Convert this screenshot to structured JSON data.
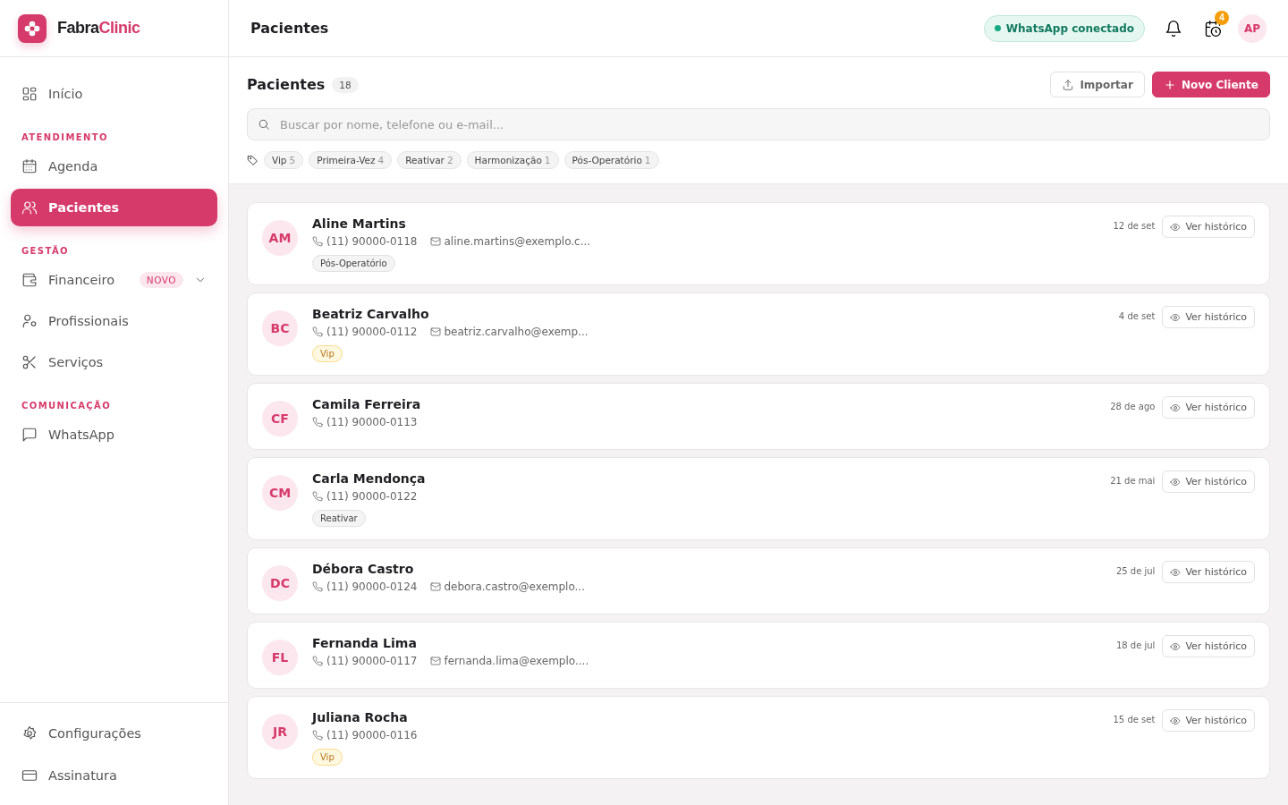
{
  "brand": {
    "name": "Fabra",
    "accent": "Clinic"
  },
  "sidebar": {
    "groups": [
      {
        "items": [
          {
            "label": "Início",
            "kind": "grid",
            "selected": false
          }
        ]
      },
      {
        "heading": "ATENDIMENTO",
        "items": [
          {
            "label": "Agenda",
            "kind": "calendar",
            "selected": false
          },
          {
            "label": "Pacientes",
            "kind": "users",
            "selected": true
          }
        ]
      },
      {
        "heading": "GESTÃO",
        "items": [
          {
            "label": "Financeiro",
            "kind": "wallet",
            "selected": false,
            "badge": "NOVO",
            "expandable": true
          },
          {
            "label": "Profissionais",
            "kind": "usercog",
            "selected": false
          },
          {
            "label": "Serviços",
            "kind": "scissors",
            "selected": false
          }
        ]
      },
      {
        "heading": "COMUNICAÇÃO",
        "items": [
          {
            "label": "WhatsApp",
            "kind": "chat",
            "selected": false
          }
        ]
      }
    ],
    "footer": [
      {
        "label": "Configurações",
        "kind": "gear",
        "selected": false
      },
      {
        "label": "Assinatura",
        "kind": "card",
        "selected": false
      }
    ]
  },
  "header": {
    "title": "Pacientes",
    "whatsapp_status": {
      "label": "WhatsApp conectado",
      "connected": true
    },
    "reminders_count": "4",
    "avatar": "AP"
  },
  "toolbar": {
    "title": "Pacientes",
    "count": "18",
    "buttons": [
      {
        "label": "Importar",
        "kind": "secondary"
      },
      {
        "label": "Novo Cliente",
        "kind": "primary"
      }
    ],
    "search": {
      "placeholder": "Buscar por nome, telefone ou e-mail..."
    },
    "tag_filters": [
      {
        "label": "Vip",
        "count": "5"
      },
      {
        "label": "Primeira-Vez",
        "count": "4"
      },
      {
        "label": "Reativar",
        "count": "2"
      },
      {
        "label": "Harmonização",
        "count": "1"
      },
      {
        "label": "Pós-Operatório",
        "count": "1"
      }
    ]
  },
  "patients": [
    {
      "initials": "AM",
      "name": "Aline Martins",
      "phone": "(11) 90000-0118",
      "email": "aline.martins@exemplo.c...",
      "tags": [
        {
          "label": "Pós-Operatório",
          "kind": "plain"
        }
      ],
      "date": "12 de set",
      "action": "Ver histórico"
    },
    {
      "initials": "BC",
      "name": "Beatriz Carvalho",
      "phone": "(11) 90000-0112",
      "email": "beatriz.carvalho@exemp...",
      "tags": [
        {
          "label": "Vip",
          "kind": "vip"
        }
      ],
      "date": "4 de set",
      "action": "Ver histórico"
    },
    {
      "initials": "CF",
      "name": "Camila Ferreira",
      "phone": "(11) 90000-0113",
      "date": "28 de ago",
      "action": "Ver histórico"
    },
    {
      "initials": "CM",
      "name": "Carla Mendonça",
      "phone": "(11) 90000-0122",
      "tags": [
        {
          "label": "Reativar",
          "kind": "plain"
        }
      ],
      "date": "21 de mai",
      "action": "Ver histórico"
    },
    {
      "initials": "DC",
      "name": "Débora Castro",
      "phone": "(11) 90000-0124",
      "email": "debora.castro@exemplo...",
      "date": "25 de jul",
      "action": "Ver histórico"
    },
    {
      "initials": "FL",
      "name": "Fernanda Lima",
      "phone": "(11) 90000-0117",
      "email": "fernanda.lima@exemplo....",
      "date": "18 de jul",
      "action": "Ver histórico"
    },
    {
      "initials": "JR",
      "name": "Juliana Rocha",
      "phone": "(11) 90000-0116",
      "tags": [
        {
          "label": "Vip",
          "kind": "vip"
        }
      ],
      "date": "15 de set",
      "action": "Ver histórico"
    }
  ]
}
